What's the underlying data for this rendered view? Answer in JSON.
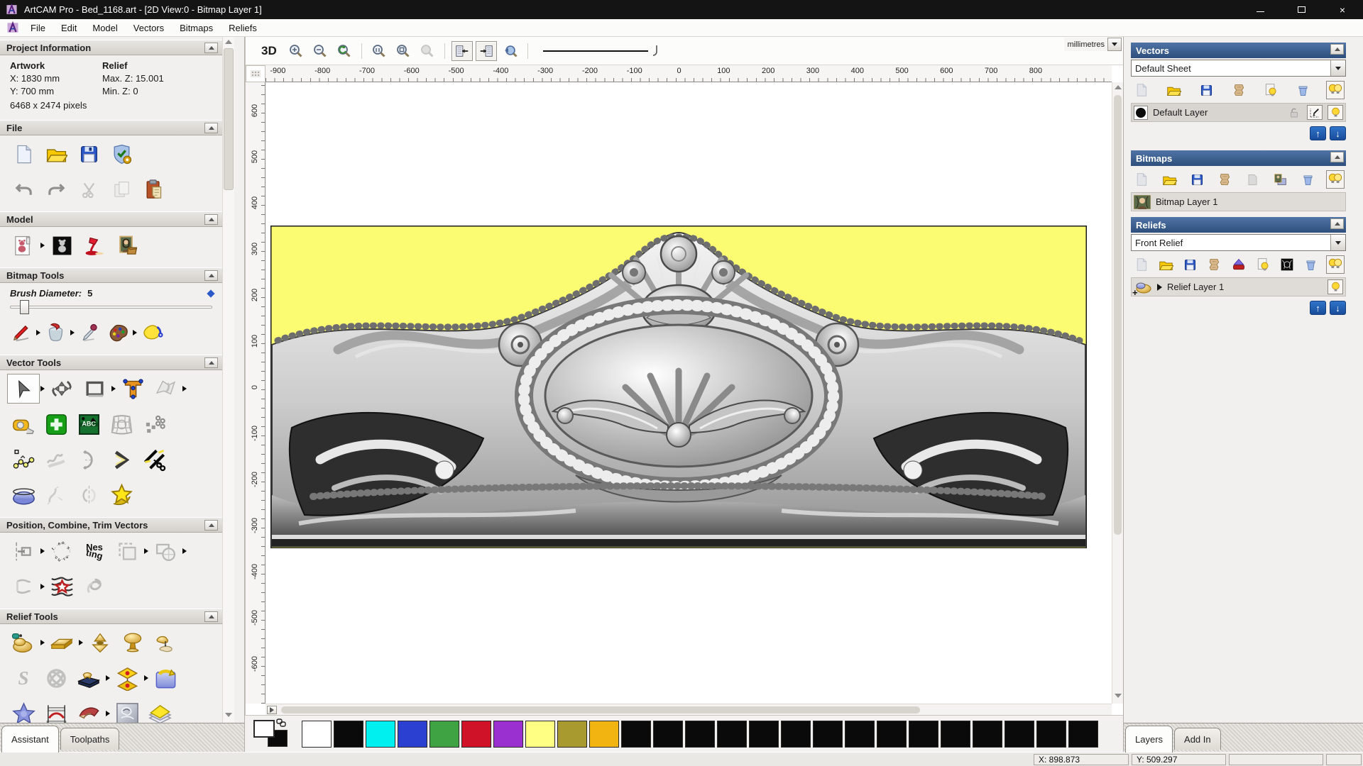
{
  "window": {
    "title": "ArtCAM Pro - Bed_1168.art - [2D View:0 - Bitmap Layer 1]",
    "buttons": [
      "minimize",
      "maximize",
      "close"
    ]
  },
  "menu": {
    "items": [
      "File",
      "Edit",
      "Model",
      "Vectors",
      "Bitmaps",
      "Reliefs"
    ]
  },
  "assistant": {
    "tabs": {
      "assistant": "Assistant",
      "toolpaths": "Toolpaths"
    },
    "project_information": {
      "title": "Project Information",
      "artwork_label": "Artwork",
      "artwork_x": "X: 1830 mm",
      "artwork_y": "Y: 700 mm",
      "artwork_pixels": "6468 x 2474 pixels",
      "relief_label": "Relief",
      "relief_max_z": "Max. Z: 15.001",
      "relief_min_z": "Min. Z: 0"
    },
    "sections": {
      "file": "File",
      "model": "Model",
      "bitmap_tools": "Bitmap Tools",
      "vector_tools": "Vector Tools",
      "position_combine_trim": "Position, Combine, Trim Vectors",
      "relief_tools": "Relief Tools"
    },
    "brush": {
      "label": "Brush Diameter:",
      "value": "5"
    },
    "nesting_icon_text": {
      "line1": "Nes",
      "line2": "ting"
    },
    "s_icon_text": "S",
    "icons": {
      "file_row1": [
        "new-model",
        "open-model",
        "save-model",
        "model-options"
      ],
      "file_row2": [
        "undo",
        "redo",
        "cut",
        "copy",
        "paste"
      ],
      "model_row": [
        "set-model-size",
        "invert-model",
        "lighting",
        "load-bitmap"
      ],
      "bitmap_row": [
        "paint-brush",
        "flood-fill",
        "colour-picker",
        "edit-palette",
        "bitmap-fill"
      ],
      "vector_row1": [
        "select-vectors",
        "transform-vectors",
        "create-rectangle",
        "create-text",
        "distort-vectors"
      ],
      "vector_row2": [
        "measure",
        "create-polygon",
        "text-in-a-box",
        "envelope-distortion",
        "block-paste"
      ],
      "vector_row3": [
        "create-polyline",
        "freehand-draw",
        "arc-fit",
        "join-vectors",
        "cut-vectors"
      ],
      "vector_row4": [
        "create-shape",
        "fit-curve",
        "mirror-vectors",
        "vector-doctor"
      ],
      "position_row1": [
        "align-vectors",
        "text-on-curve",
        "nesting",
        "group-vectors",
        "weld-vectors"
      ],
      "position_row2": [
        "trim-vectors",
        "fit-vectors-to-curves",
        "spiral"
      ],
      "relief_row1": [
        "shape-editor",
        "add-plane",
        "two-cone-shape",
        "mushroom-shape",
        "combine-reliefs"
      ],
      "relief_row2": [
        "sculpt",
        "weave-wizard",
        "relief-clipart-library",
        "offset-relief",
        "wrap-relief"
      ],
      "relief_row3": [
        "star-shape",
        "two-rail-sweep",
        "swept-profile",
        "texture-relief",
        "relief-envelope"
      ],
      "relief_row4": [
        "extrude",
        "weave",
        "dome",
        "sphere",
        "splat"
      ]
    }
  },
  "view2d": {
    "toolbar": {
      "to_3d": "3D",
      "icons": [
        "zoom-in",
        "zoom-out",
        "zoom-previous",
        "zoom-1to1",
        "zoom-object",
        "zoom-selection",
        "snap-grid",
        "snap-guides",
        "pan-view",
        "line-width-selector"
      ]
    },
    "h_ruler": {
      "labels": [
        "-900",
        "-800",
        "-700",
        "-600",
        "-500",
        "-400",
        "-300",
        "-200",
        "-100",
        "0",
        "100",
        "200",
        "300",
        "400",
        "500",
        "600",
        "700",
        "800"
      ],
      "units": "millimetres"
    },
    "v_ruler": {
      "labels": [
        "600",
        "500",
        "400",
        "300",
        "200",
        "100",
        "0",
        "-100",
        "-200",
        "-300",
        "-400",
        "-500",
        "-600"
      ]
    },
    "model_background_color": "#fcfc72"
  },
  "palette": {
    "primary_color": "#ffffff",
    "secondary_color": "#0a0a0a",
    "colors": [
      "#ffffff",
      "#0a0a0a",
      "#00f0f0",
      "#2b3fd0",
      "#3fa344",
      "#d01228",
      "#9b30d0",
      "#ffff84",
      "#a89a2e",
      "#f2b411",
      "#0a0a0a",
      "#0a0a0a",
      "#0a0a0a",
      "#0a0a0a",
      "#0a0a0a",
      "#0a0a0a",
      "#0a0a0a",
      "#0a0a0a",
      "#0a0a0a",
      "#0a0a0a",
      "#0a0a0a",
      "#0a0a0a",
      "#0a0a0a",
      "#0a0a0a",
      "#0a0a0a"
    ]
  },
  "layers_panel": {
    "tabs": {
      "layers": "Layers",
      "add_in": "Add In"
    },
    "vectors": {
      "title": "Vectors",
      "sheet": "Default Sheet",
      "layer": "Default Layer",
      "icons": [
        "new-layer",
        "open-layer",
        "save-layer",
        "merge-layers",
        "toggle-page-visibility",
        "delete-layer",
        "all-layers-visibility"
      ],
      "layer_buttons": [
        "lock-layer",
        "snap-layer",
        "layer-visibility"
      ]
    },
    "bitmaps": {
      "title": "Bitmaps",
      "layer": "Bitmap Layer 1",
      "icons": [
        "new-layer",
        "open-layer",
        "save-layer",
        "merge-layers",
        "clear-layer",
        "bitmap-preview",
        "delete-layer",
        "all-layers-visibility"
      ]
    },
    "reliefs": {
      "title": "Reliefs",
      "relief": "Front Relief",
      "layer": "Relief Layer 1",
      "icons": [
        "new-layer",
        "open-layer",
        "save-layer",
        "merge-layers",
        "stamp-relief",
        "toggle-page-visibility",
        "texture-preview",
        "delete-layer",
        "all-layers-visibility"
      ]
    }
  },
  "status_bar": {
    "x": "X: 898.873",
    "y": "Y: 509.297"
  }
}
